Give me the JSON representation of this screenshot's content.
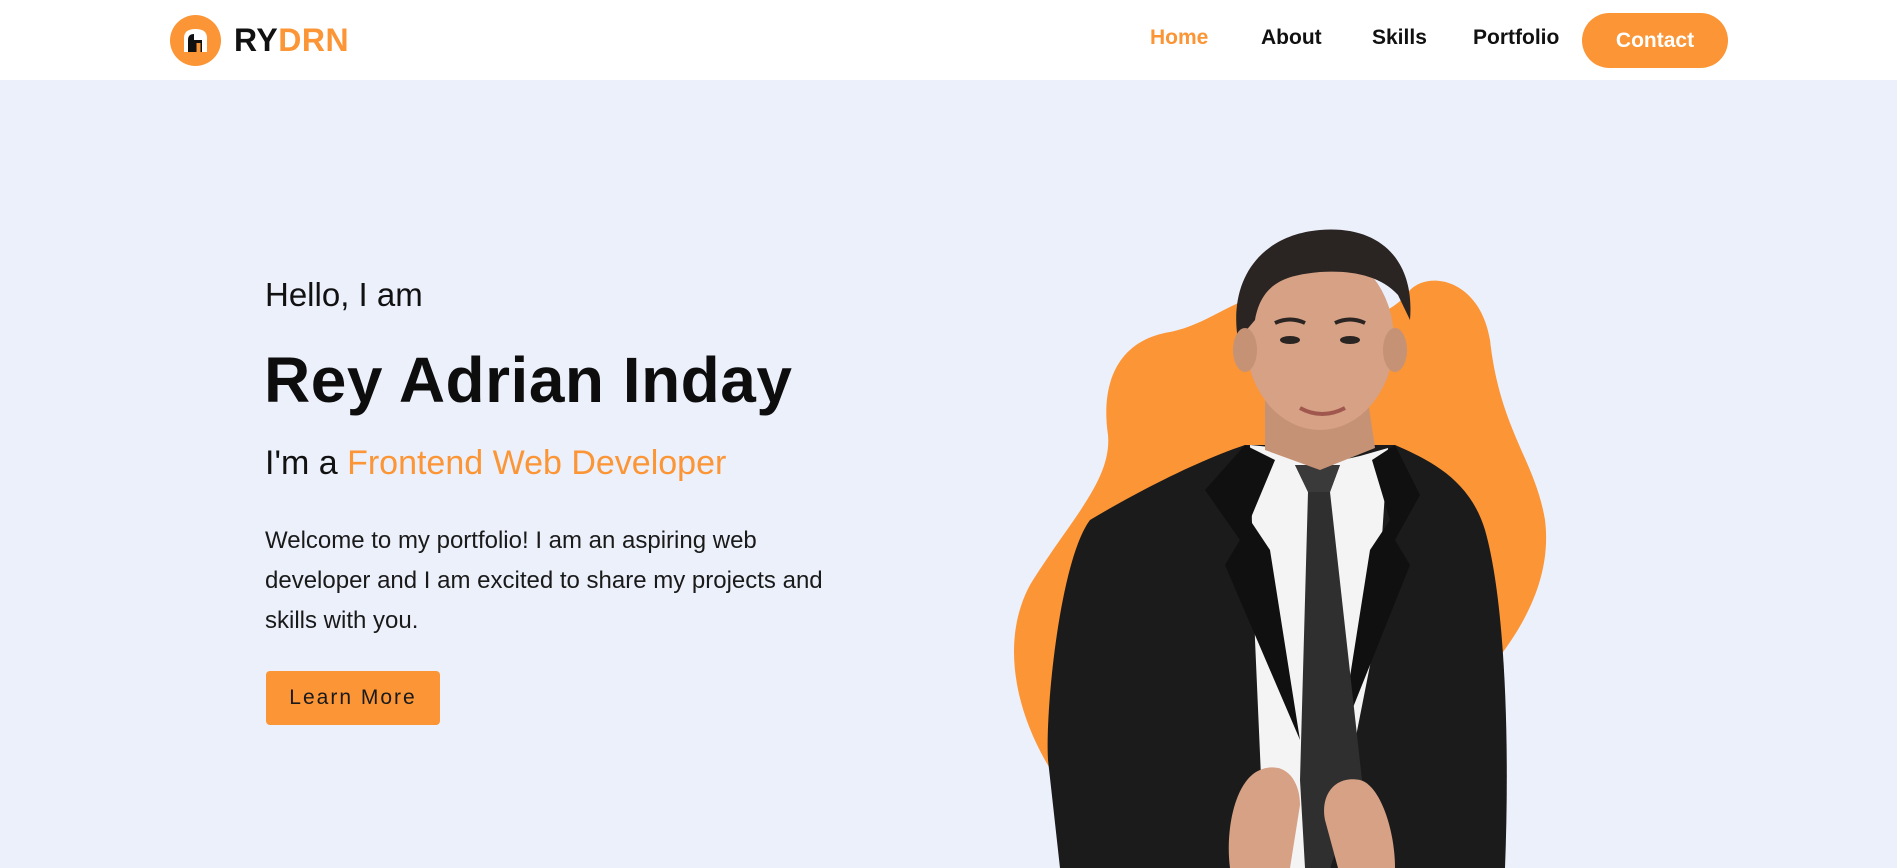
{
  "brand": {
    "part1": "RY",
    "part2": "DRN"
  },
  "nav": {
    "home": "Home",
    "about": "About",
    "skills": "Skills",
    "portfolio": "Portfolio",
    "contact": "Contact"
  },
  "hero": {
    "greeting": "Hello, I am",
    "name": "Rey Adrian Inday",
    "role_prefix": "I'm a ",
    "role_highlight": "Frontend Web Developer",
    "description": "Welcome to my portfolio! I am an aspiring web developer and I am excited to share my projects and skills with you.",
    "cta": "Learn More"
  },
  "colors": {
    "accent": "#fb9535",
    "background": "#ecf0fb",
    "navbar": "#ffffff",
    "text": "#111111"
  },
  "icons": {
    "logo": "house-logo-icon"
  }
}
